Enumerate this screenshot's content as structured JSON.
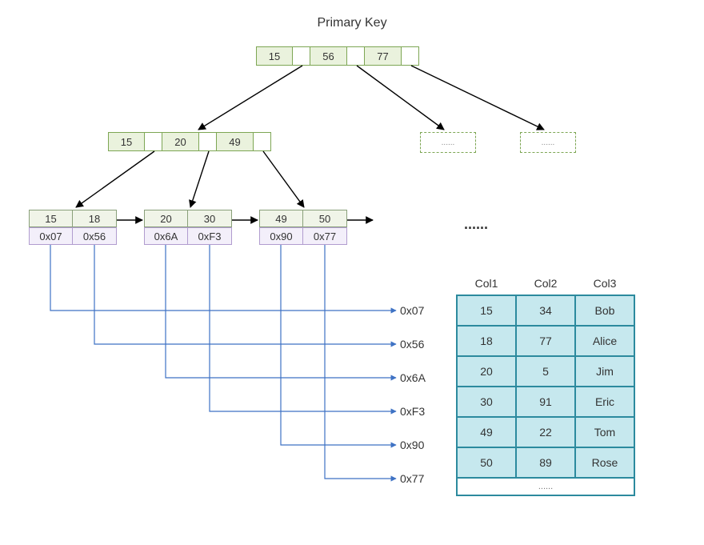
{
  "title": "Primary Key",
  "root": {
    "keys": [
      "15",
      "56",
      "77"
    ]
  },
  "mid": {
    "keys": [
      "15",
      "20",
      "49"
    ]
  },
  "leaves": [
    {
      "keys": [
        "15",
        "18"
      ],
      "ptrs": [
        "0x07",
        "0x56"
      ]
    },
    {
      "keys": [
        "20",
        "30"
      ],
      "ptrs": [
        "0x6A",
        "0xF3"
      ]
    },
    {
      "keys": [
        "49",
        "50"
      ],
      "ptrs": [
        "0x90",
        "0x77"
      ]
    }
  ],
  "more_marker": "......",
  "row_addrs": [
    "0x07",
    "0x56",
    "0x6A",
    "0xF3",
    "0x90",
    "0x77"
  ],
  "table": {
    "headers": [
      "Col1",
      "Col2",
      "Col3"
    ],
    "rows": [
      [
        "15",
        "34",
        "Bob"
      ],
      [
        "18",
        "77",
        "Alice"
      ],
      [
        "20",
        "5",
        "Jim"
      ],
      [
        "30",
        "91",
        "Eric"
      ],
      [
        "49",
        "22",
        "Tom"
      ],
      [
        "50",
        "89",
        "Rose"
      ]
    ],
    "more": "......"
  }
}
